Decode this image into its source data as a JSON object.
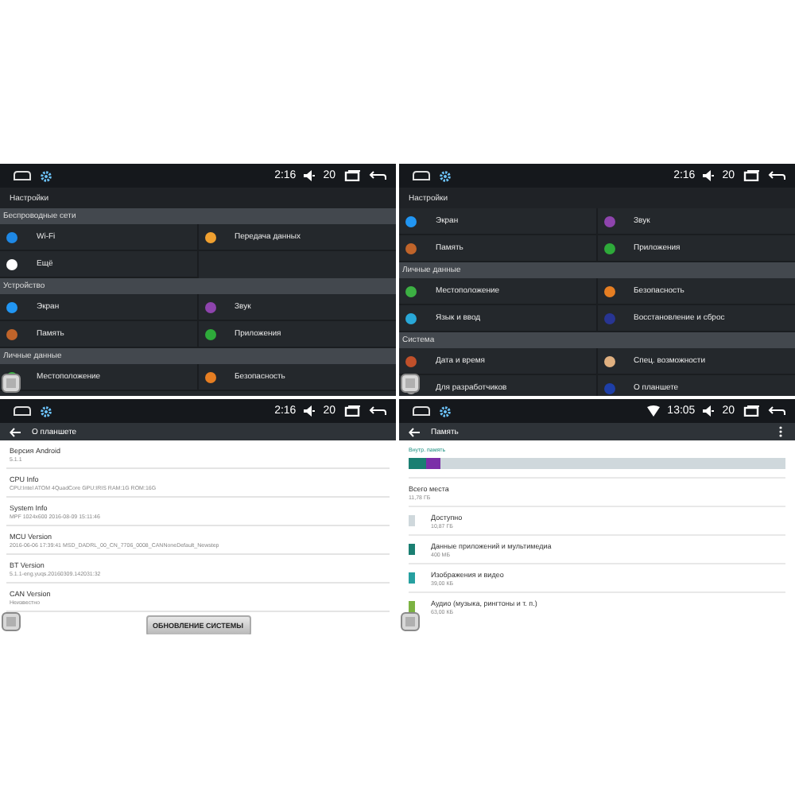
{
  "screens": [
    {
      "kind": "settings",
      "status_bar": {
        "time": "2:16",
        "volume": "20",
        "wifi": false
      },
      "title": "Настройки",
      "groups": [
        {
          "header": "Беспроводные сети",
          "items": [
            {
              "label": "Wi-Fi",
              "color": "#1e88e5"
            },
            {
              "label": "Передача данных",
              "color": "#f0a030"
            },
            {
              "label": "Ещё",
              "color": "#ffffff"
            }
          ]
        },
        {
          "header": "Устройство",
          "items": [
            {
              "label": "Экран",
              "color": "#2196f3"
            },
            {
              "label": "Звук",
              "color": "#8e44ad"
            },
            {
              "label": "Память",
              "color": "#c0642a"
            },
            {
              "label": "Приложения",
              "color": "#2eaa3a"
            }
          ]
        },
        {
          "header": "Личные данные",
          "items": [
            {
              "label": "Местоположение",
              "color": "#3cb043"
            },
            {
              "label": "Безопасность",
              "color": "#e67e22"
            }
          ]
        }
      ]
    },
    {
      "kind": "settings",
      "status_bar": {
        "time": "2:16",
        "volume": "20",
        "wifi": false
      },
      "title": "Настройки",
      "groups": [
        {
          "items": [
            {
              "label": "Экран",
              "color": "#2196f3"
            },
            {
              "label": "Звук",
              "color": "#8e44ad"
            },
            {
              "label": "Память",
              "color": "#c0642a"
            },
            {
              "label": "Приложения",
              "color": "#2eaa3a"
            }
          ]
        },
        {
          "header": "Личные данные",
          "items": [
            {
              "label": "Местоположение",
              "color": "#3cb043"
            },
            {
              "label": "Безопасность",
              "color": "#e67e22"
            },
            {
              "label": "Язык и ввод",
              "color": "#29a8d8"
            },
            {
              "label": "Восстановление и сброс",
              "color": "#283593"
            }
          ]
        },
        {
          "header": "Система",
          "items": [
            {
              "label": "Дата и время",
              "color": "#c0502a"
            },
            {
              "label": "Спец. возможности",
              "color": "#e0b080"
            },
            {
              "label": "Для разработчиков",
              "color": "#9e9e9e"
            },
            {
              "label": "О планшете",
              "color": "#1e3fa8"
            }
          ]
        }
      ]
    },
    {
      "kind": "about",
      "status_bar": {
        "time": "2:16",
        "volume": "20",
        "wifi": false
      },
      "title": "О планшете",
      "rows": [
        {
          "name": "Версия Android",
          "value": "5.1.1"
        },
        {
          "name": "CPU Info",
          "value": "CPU:Intel ATOM 4QuadCore GPU:IRIS RAM:1G ROM:16G"
        },
        {
          "name": "System Info",
          "value": "MPF 1024x600 2016-08-09 15:11:46"
        },
        {
          "name": "MCU Version",
          "value": "2016-06-06 17:39:41 MSD_DADRL_00_CN_7706_0008_CANNoneDefault_Newstep"
        },
        {
          "name": "BT Version",
          "value": "5.1.1-eng.yuqs.20160309.142031:32"
        },
        {
          "name": "CAN Version",
          "value": "Неизвестно"
        }
      ],
      "button": "ОБНОВЛЕНИЕ СИСТЕМЫ"
    },
    {
      "kind": "storage",
      "status_bar": {
        "time": "13:05",
        "volume": "20",
        "wifi": true
      },
      "title": "Память",
      "label": "Внутр. память",
      "bar": [
        {
          "color": "#1a7f72",
          "level": 0.045
        },
        {
          "color": "#7b2fa8",
          "level": 0.04
        }
      ],
      "rows": [
        {
          "name": "Всего места",
          "value": "11,78 ГБ"
        },
        {
          "name": "Доступно",
          "value": "10,87 ГБ",
          "color": "#cfd8dc"
        },
        {
          "name": "Данные приложений и мультимедиа",
          "value": "400 МБ",
          "color": "#1a7f72"
        },
        {
          "name": "Изображения и видео",
          "value": "39,00 КБ",
          "color": "#26a0a0"
        },
        {
          "name": "Аудио (музыка, рингтоны и т. п.)",
          "value": "63,00 КБ",
          "color": "#7cb342"
        }
      ]
    }
  ]
}
